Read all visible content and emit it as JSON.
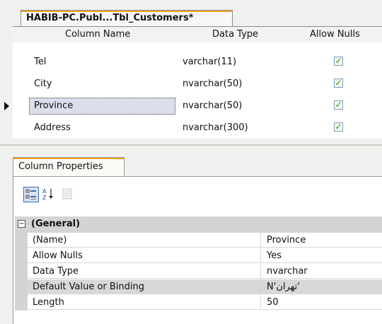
{
  "document_tab": {
    "title": "HABIB-PC.Publ...Tbl_Customers*"
  },
  "table_grid": {
    "headers": {
      "column_name": "Column Name",
      "data_type": "Data Type",
      "allow_nulls": "Allow Nulls"
    },
    "rows": [
      {
        "name": "Tel",
        "type": "varchar(11)",
        "allow_nulls": true
      },
      {
        "name": "City",
        "type": "nvarchar(50)",
        "allow_nulls": true
      },
      {
        "name": "Province",
        "type": "nvarchar(50)",
        "allow_nulls": true
      },
      {
        "name": "Address",
        "type": "nvarchar(300)",
        "allow_nulls": true
      }
    ],
    "selected_row": "Province"
  },
  "column_properties": {
    "tab_label": "Column Properties",
    "toolbar": [
      "categorized-icon",
      "alphabetical-sort-icon",
      "property-pages-icon"
    ],
    "category": {
      "label": "(General)",
      "toggle_symbol": "⊟"
    },
    "properties": [
      {
        "name": "(Name)",
        "value": "Province"
      },
      {
        "name": "Allow Nulls",
        "value": "Yes"
      },
      {
        "name": "Data Type",
        "value": "nvarchar"
      },
      {
        "name": "Default Value or Binding",
        "value": "N'تهران'"
      },
      {
        "name": "Length",
        "value": "50"
      }
    ]
  },
  "colors": {
    "tab_accent": "#f2a623",
    "check_green": "#2b9a1e",
    "selected_cell": "#dcdfeb"
  }
}
